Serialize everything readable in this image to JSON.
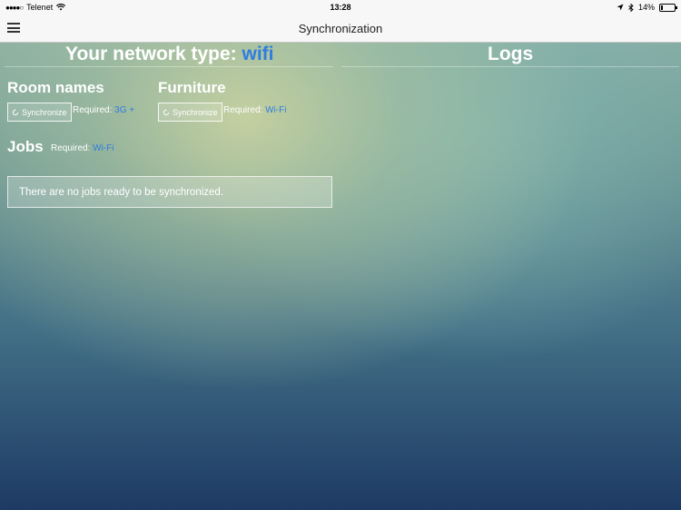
{
  "status_bar": {
    "carrier": "Telenet",
    "time": "13:28",
    "battery": "14%",
    "battery_level": 0.14
  },
  "nav": {
    "title": "Synchronization"
  },
  "network": {
    "label": "Your network type:",
    "type": "wifi"
  },
  "logs": {
    "title": "Logs"
  },
  "room_names": {
    "title": "Room names",
    "button": "Synchronize",
    "required_label": "Required:",
    "required_value": "3G +"
  },
  "furniture": {
    "title": "Furniture",
    "button": "Synchronize",
    "required_label": "Required:",
    "required_value": "Wi-Fi"
  },
  "jobs": {
    "title": "Jobs",
    "required_label": "Required:",
    "required_value": "Wi-Fi",
    "empty_message": "There are no jobs ready to be synchronized."
  },
  "colors": {
    "accent": "#2f7de0",
    "bar": "#f7f7f7"
  }
}
